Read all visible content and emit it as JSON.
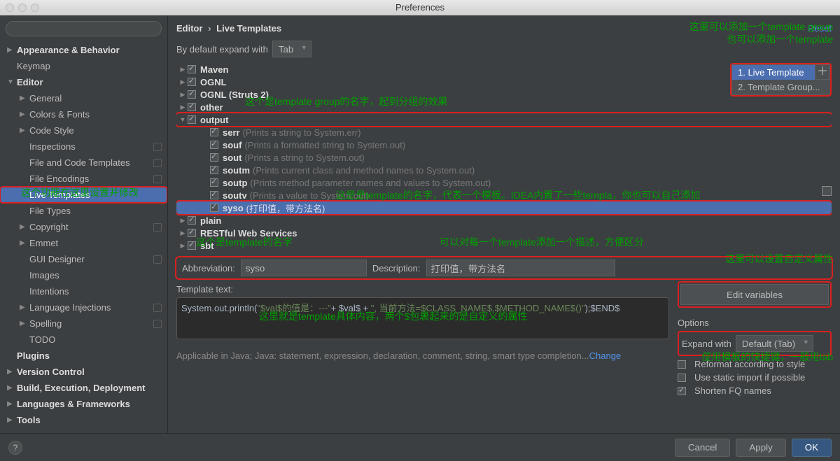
{
  "window_title": "Preferences",
  "breadcrumb": {
    "path1": "Editor",
    "sep": "›",
    "path2": "Live Templates",
    "reset": "Reset"
  },
  "expand_default_label": "By default expand with",
  "expand_default_value": "Tab",
  "sidebar": [
    {
      "label": "Appearance & Behavior",
      "bold": true,
      "arrow": "right",
      "indent": 0
    },
    {
      "label": "Keymap",
      "indent": 0
    },
    {
      "label": "Editor",
      "bold": true,
      "arrow": "down",
      "indent": 0
    },
    {
      "label": "General",
      "arrow": "right",
      "indent": 1
    },
    {
      "label": "Colors & Fonts",
      "arrow": "right",
      "indent": 1
    },
    {
      "label": "Code Style",
      "arrow": "right",
      "indent": 1
    },
    {
      "label": "Inspections",
      "indent": 1,
      "badge": true
    },
    {
      "label": "File and Code Templates",
      "indent": 1,
      "badge": true
    },
    {
      "label": "File Encodings",
      "indent": 1,
      "badge": true
    },
    {
      "label": "Live Templates",
      "indent": 1,
      "selected": true
    },
    {
      "label": "File Types",
      "indent": 1
    },
    {
      "label": "Copyright",
      "arrow": "right",
      "indent": 1,
      "badge": true
    },
    {
      "label": "Emmet",
      "arrow": "right",
      "indent": 1
    },
    {
      "label": "GUI Designer",
      "indent": 1,
      "badge": true
    },
    {
      "label": "Images",
      "indent": 1
    },
    {
      "label": "Intentions",
      "indent": 1
    },
    {
      "label": "Language Injections",
      "arrow": "right",
      "indent": 1,
      "badge": true
    },
    {
      "label": "Spelling",
      "arrow": "right",
      "indent": 1,
      "badge": true
    },
    {
      "label": "TODO",
      "indent": 1
    },
    {
      "label": "Plugins",
      "bold": true,
      "indent": 0
    },
    {
      "label": "Version Control",
      "bold": true,
      "arrow": "right",
      "indent": 0
    },
    {
      "label": "Build, Execution, Deployment",
      "bold": true,
      "arrow": "right",
      "indent": 0
    },
    {
      "label": "Languages & Frameworks",
      "bold": true,
      "arrow": "right",
      "indent": 0
    },
    {
      "label": "Tools",
      "bold": true,
      "arrow": "right",
      "indent": 0
    }
  ],
  "tpl_groups": [
    {
      "name": "Maven",
      "arrow": "right",
      "level": 0,
      "checked": true
    },
    {
      "name": "OGNL",
      "arrow": "right",
      "level": 0,
      "checked": true
    },
    {
      "name": "OGNL (Struts 2)",
      "arrow": "right",
      "level": 0,
      "checked": true
    },
    {
      "name": "other",
      "arrow": "right",
      "level": 0,
      "checked": true
    },
    {
      "name": "output",
      "arrow": "down",
      "level": 0,
      "checked": true,
      "red": true
    },
    {
      "name": "serr",
      "hint": "(Prints a string to System.err)",
      "level": 1,
      "checked": true
    },
    {
      "name": "souf",
      "hint": "(Prints a formatted string to System.out)",
      "level": 1,
      "checked": true
    },
    {
      "name": "sout",
      "hint": "(Prints a string to System.out)",
      "level": 1,
      "checked": true
    },
    {
      "name": "soutm",
      "hint": "(Prints current class and method names to System.out)",
      "level": 1,
      "checked": true
    },
    {
      "name": "soutp",
      "hint": "(Prints method parameter names and values to System.out)",
      "level": 1,
      "checked": true
    },
    {
      "name": "soutv",
      "hint": "(Prints a value to System.out)",
      "level": 1,
      "checked": true
    },
    {
      "name": "syso",
      "hint": "(打印值，带方法名)",
      "level": 1,
      "checked": true,
      "selected": true,
      "red": true
    },
    {
      "name": "plain",
      "arrow": "right",
      "level": 0,
      "checked": true
    },
    {
      "name": "RESTful Web Services",
      "arrow": "right",
      "level": 0,
      "checked": true
    },
    {
      "name": "sbt",
      "arrow": "right",
      "level": 0,
      "checked": true
    }
  ],
  "add_menu": {
    "item1": "1. Live Template",
    "item2": "2. Template Group..."
  },
  "abbr_label": "Abbreviation:",
  "abbr_value": "syso",
  "desc_label": "Description:",
  "desc_value": "打印值，带方法名",
  "tpl_text_label": "Template text:",
  "tpl_code_pre": "System.out.println(",
  "tpl_code_str1": "\"$val$的值是：---\"",
  "tpl_code_plus1": "+ $val$ + ",
  "tpl_code_str2": "\", 当前方法=$CLASS_NAME$.$METHOD_NAME$()\"",
  "tpl_code_end": ");$END$",
  "edit_vars": "Edit variables",
  "options_label": "Options",
  "expand_with_label": "Expand with",
  "expand_with_value": "Default (Tab)",
  "reformat_label": "Reformat according to style",
  "static_import_label": "Use static import if possible",
  "shorten_label": "Shorten FQ names",
  "applicable_text": "Applicable in Java; Java: statement, expression, declaration, comment, string, smart type completion...",
  "applicable_change": "Change",
  "notes": {
    "n1": "这个功能在这里设置并修改",
    "n2": "这个是template group的名字，起到分组的效果",
    "n3": "这是是template的名字，代表一个模板。IDEA内置了一些templa，你也可以自己添加",
    "n4": "这里可以添加一个template group",
    "n4b": "也可以添加一个template",
    "n5": "这个是template的名字",
    "n6": "可以对每一个template添加一个描述，方便区分",
    "n7": "这里可以设置自定义属性",
    "n8": "这里就是template具体内容，两个$包裹起来的是自定义的属性",
    "n9": "使用模板的快捷键，一般用tab"
  },
  "footer": {
    "cancel": "Cancel",
    "apply": "Apply",
    "ok": "OK"
  }
}
